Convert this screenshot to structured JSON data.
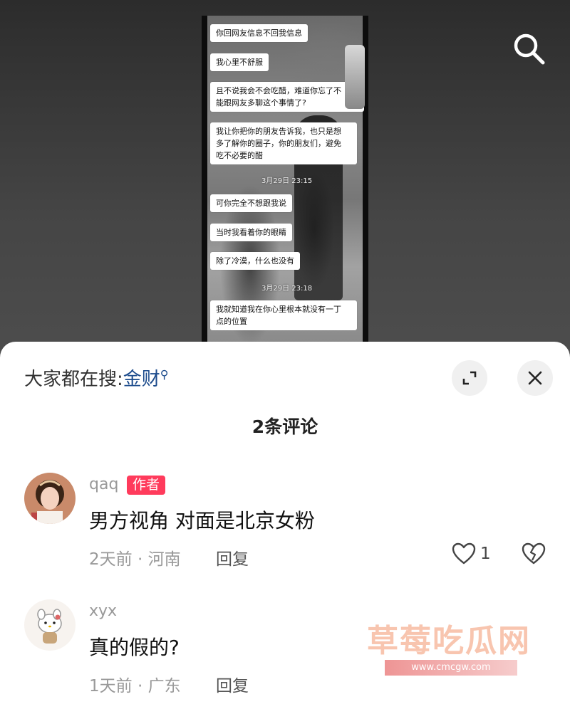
{
  "video": {
    "chat_messages": [
      "你回网友信息不回我信息",
      "我心里不舒服",
      "且不说我会不会吃醋，难道你忘了不\n能跟网友多聊这个事情了?",
      "我让你把你的朋友告诉我，也只是想\n多了解你的圈子，你的朋友们，避免\n吃不必要的醋",
      "可你完全不想跟我说",
      "当时我看着你的眼睛",
      "除了冷漠，什么也没有",
      "我就知道我在你心里根本就没有一丁\n点的位置"
    ],
    "timestamps": [
      "3月29日 23:15",
      "3月29日 23:18"
    ]
  },
  "hot_search": {
    "prefix": "大家都在搜:",
    "keyword": "金财",
    "icon": "search-icon"
  },
  "sheet_title": "2条评论",
  "comments": [
    {
      "username": "qaq",
      "tag": "作者",
      "text": "男方视角 对面是北京女粉",
      "meta": "2天前 · 河南",
      "reply_label": "回复",
      "likes": "1"
    },
    {
      "username": "xyx",
      "text": "真的假的?",
      "meta": "1天前 · 广东",
      "reply_label": "回复"
    }
  ],
  "watermark": {
    "text": "草莓吃瓜网",
    "url": "www.cmcgw.com"
  },
  "colors": {
    "accent_link": "#1c4b8c",
    "author_tag": "#ff3b5c",
    "watermark": "#f2966e"
  }
}
